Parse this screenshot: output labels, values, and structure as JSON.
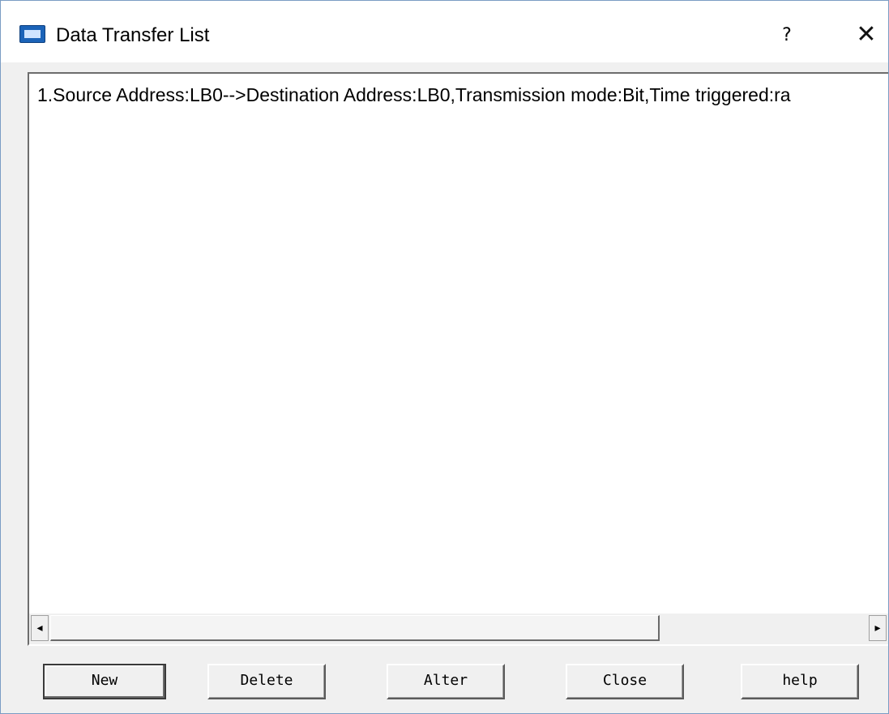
{
  "window": {
    "title": "Data Transfer List",
    "help_glyph": "?",
    "close_glyph": "✕",
    "app_icon": "hmi-icon"
  },
  "list": {
    "items": [
      "1.Source Address:LB0-->Destination Address:LB0,Transmission mode:Bit,Time triggered:ra"
    ]
  },
  "scrollbar": {
    "left_arrow": "◂",
    "right_arrow": "▸"
  },
  "buttons": {
    "new": "New",
    "delete": "Delete",
    "alter": "Alter",
    "close": "Close",
    "help": "help"
  },
  "colors": {
    "accent": "#1b63b8",
    "window_border": "#7a9cc4"
  }
}
